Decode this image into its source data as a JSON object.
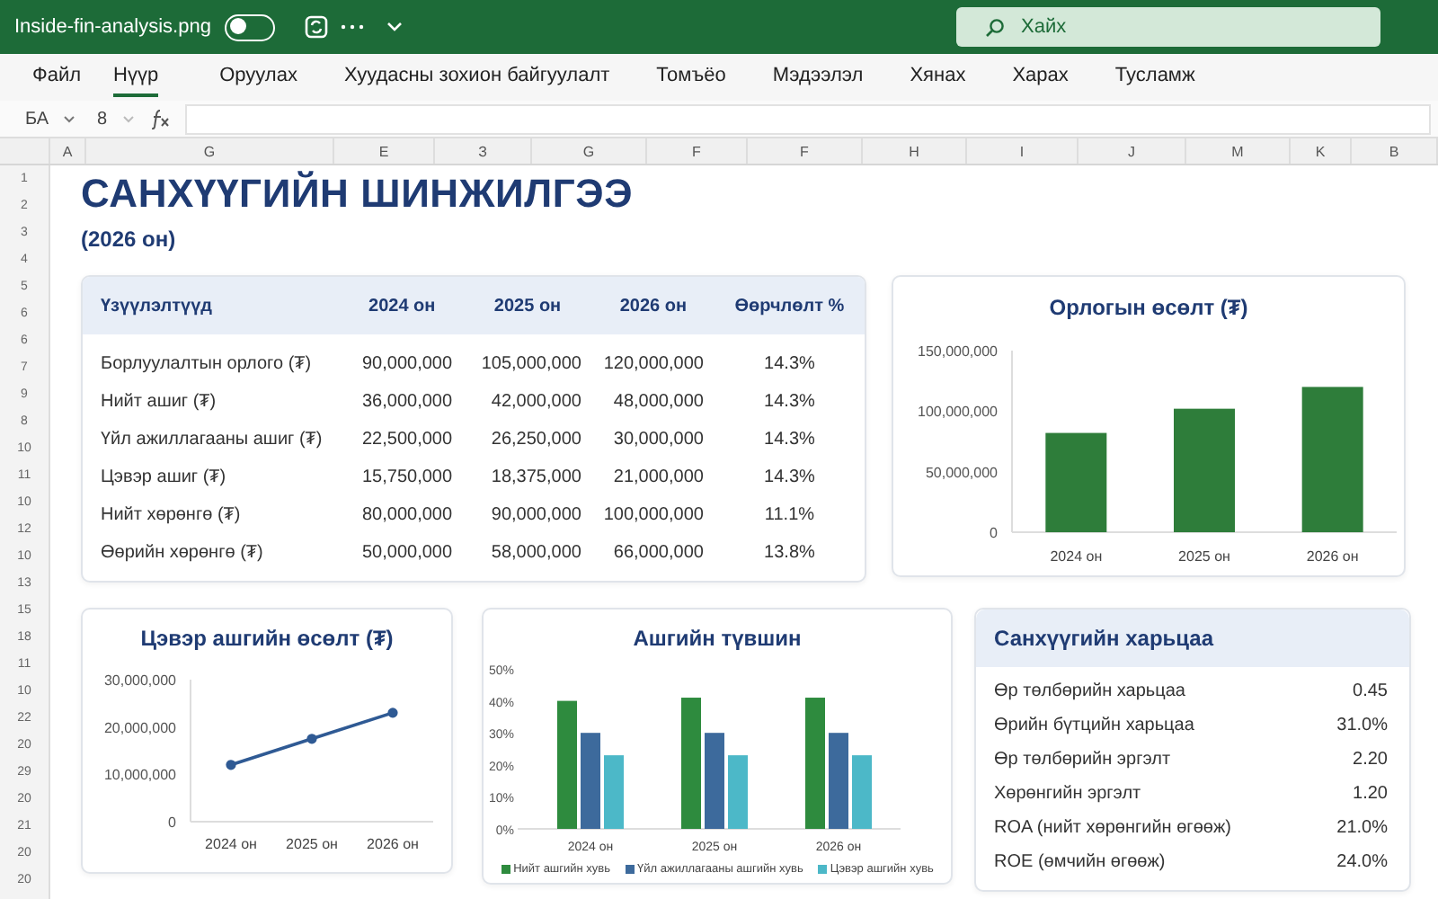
{
  "window": {
    "title": "Inside-fin-analysis.png",
    "autosave": {
      "on": false
    },
    "search": {
      "placeholder": "Хайх"
    }
  },
  "menu": [
    {
      "label": "Файл",
      "selected": false
    },
    {
      "label": "Нүүр",
      "selected": true
    },
    {
      "label": "Оруулах",
      "selected": false
    },
    {
      "label": "Хуудасны зохион байгуулалт",
      "selected": false
    },
    {
      "label": "Томъёо",
      "selected": false
    },
    {
      "label": "Мэдээлэл",
      "selected": false
    },
    {
      "label": "Хянах",
      "selected": false
    },
    {
      "label": "Харах",
      "selected": false
    },
    {
      "label": "Тусламж",
      "selected": false
    }
  ],
  "formula_bar": {
    "cell_name": "БА",
    "font_size": "8"
  },
  "column_headers": [
    "A",
    "G",
    "E",
    "З",
    "G",
    "F",
    "F",
    "H",
    "I",
    "J",
    "M",
    "K",
    "B"
  ],
  "row_numbers": [
    "1",
    "2",
    "3",
    "4",
    "5",
    "6",
    "6",
    "7",
    "9",
    "8",
    "10",
    "11",
    "10",
    "12",
    "10",
    "13",
    "15",
    "18",
    "11",
    "10",
    "22",
    "20",
    "29",
    "20",
    "21",
    "20",
    "20"
  ],
  "sheet": {
    "title": "САНХҮҮГИЙН ШИНЖИЛГЭЭ",
    "subtitle": "(2026 он)",
    "table": {
      "columns": [
        "Үзүүлэлтүүд",
        "2024 он",
        "2025 он",
        "2026 он",
        "Өөрчлөлт %"
      ],
      "rows": [
        [
          "Борлуулалтын орлого (₮)",
          "90,000,000",
          "105,000,000",
          "120,000,000",
          "14.3%"
        ],
        [
          "Нийт ашиг (₮)",
          "36,000,000",
          "42,000,000",
          "48,000,000",
          "14.3%"
        ],
        [
          "Үйл ажиллагааны ашиг (₮)",
          "22,500,000",
          "26,250,000",
          "30,000,000",
          "14.3%"
        ],
        [
          "Цэвэр ашиг (₮)",
          "15,750,000",
          "18,375,000",
          "21,000,000",
          "14.3%"
        ],
        [
          "Нийт хөрөнгө (₮)",
          "80,000,000",
          "90,000,000",
          "100,000,000",
          "11.1%"
        ],
        [
          "Өөрийн хөрөнгө (₮)",
          "50,000,000",
          "58,000,000",
          "66,000,000",
          "13.8%"
        ]
      ]
    },
    "revenue_chart": {
      "chart_data": {
        "type": "bar",
        "title": "Орлогын өсөлт (₮)",
        "categories": [
          "2024 он",
          "2025 он",
          "2026 он"
        ],
        "series": [
          {
            "color": "#2e7d3a",
            "values": [
              82000000,
              102000000,
              120000000
            ]
          }
        ],
        "ylim": [
          0,
          150000000
        ],
        "yticks": [
          {
            "value": 0,
            "label": "0"
          },
          {
            "value": 50000000,
            "label": "50,000,000"
          },
          {
            "value": 100000000,
            "label": "100,000,000"
          },
          {
            "value": 150000000,
            "label": "150,000,000"
          }
        ]
      }
    },
    "net_profit_chart": {
      "chart_data": {
        "type": "line",
        "title": "Цэвэр ашгийн өсөлт (₮)",
        "categories": [
          "2024 он",
          "2025 он",
          "2026 он"
        ],
        "series": [
          {
            "color": "#2f5a94",
            "marker": "circle",
            "values": [
              12000000,
              17500000,
              23000000
            ]
          }
        ],
        "ylim": [
          0,
          30000000
        ],
        "yticks": [
          {
            "value": 0,
            "label": "0"
          },
          {
            "value": 10000000,
            "label": "10,000,000"
          },
          {
            "value": 20000000,
            "label": "20,000,000"
          },
          {
            "value": 30000000,
            "label": "30,000,000"
          }
        ]
      }
    },
    "margin_chart": {
      "chart_data": {
        "type": "bar",
        "title": "Ашгийн түвшин",
        "categories": [
          "2024 он",
          "2025 он",
          "2026 он"
        ],
        "series": [
          {
            "name": "Нийт ашгийн хувь",
            "color": "#2e8b3e",
            "values": [
              40,
              41,
              41
            ]
          },
          {
            "name": "Үйл ажиллагааны ашгийн хувь",
            "color": "#3d6a9c",
            "values": [
              30,
              30,
              30
            ]
          },
          {
            "name": "Цэвэр ашгийн хувь",
            "color": "#4cb8c8",
            "values": [
              23,
              23,
              23
            ]
          }
        ],
        "ylim": [
          0,
          50
        ],
        "yticks": [
          {
            "value": 0,
            "label": "0%"
          },
          {
            "value": 10,
            "label": "10%"
          },
          {
            "value": 20,
            "label": "20%"
          },
          {
            "value": 30,
            "label": "30%"
          },
          {
            "value": 40,
            "label": "40%"
          },
          {
            "value": 50,
            "label": "50%"
          }
        ]
      }
    },
    "ratios": {
      "title": "Санхүүгийн харьцаа",
      "rows": [
        {
          "label": "Өр төлбөрийн харьцаа",
          "value": "0.45"
        },
        {
          "label": "Өрийн бүтцийн харьцаа",
          "value": "31.0%"
        },
        {
          "label": "Өр төлбөрийн эргэлт",
          "value": "2.20"
        },
        {
          "label": "Хөрөнгийн эргэлт",
          "value": "1.20"
        },
        {
          "label": "ROA (нийт хөрөнгийн өгөөж)",
          "value": "21.0%"
        },
        {
          "label": "ROE (өмчийн өгөөж)",
          "value": "24.0%"
        }
      ]
    }
  }
}
